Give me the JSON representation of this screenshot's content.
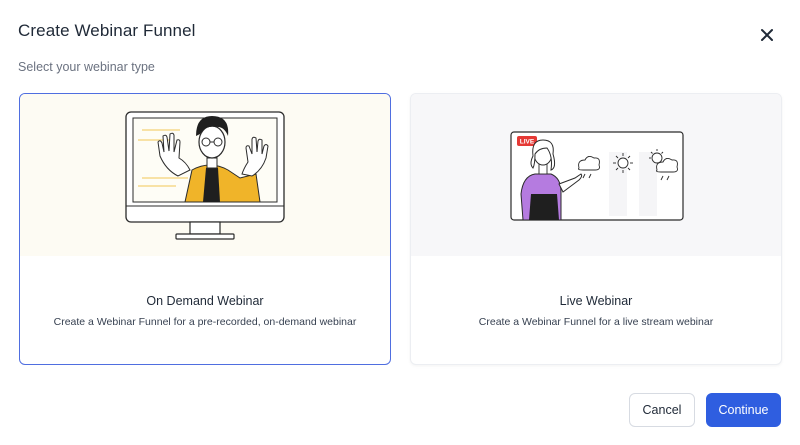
{
  "dialog": {
    "title": "Create Webinar Funnel",
    "subtitle": "Select your webinar type"
  },
  "options": [
    {
      "title": "On Demand Webinar",
      "description": "Create a Webinar Funnel for a pre-recorded, on-demand webinar",
      "selected": true,
      "illustration": "person-waving-on-monitor"
    },
    {
      "title": "Live Webinar",
      "description": "Create a Webinar Funnel for a live stream webinar",
      "selected": false,
      "illustration": "presenter-weather-board",
      "badge": "LIVE"
    }
  ],
  "footer": {
    "cancel_label": "Cancel",
    "continue_label": "Continue"
  },
  "colors": {
    "primary": "#2f5ee0",
    "selected_border": "#4f6ee0",
    "accent_yellow": "#f0b429",
    "accent_purple": "#b57be0",
    "live_red": "#e53935"
  },
  "icons": {
    "close": "close-icon"
  }
}
